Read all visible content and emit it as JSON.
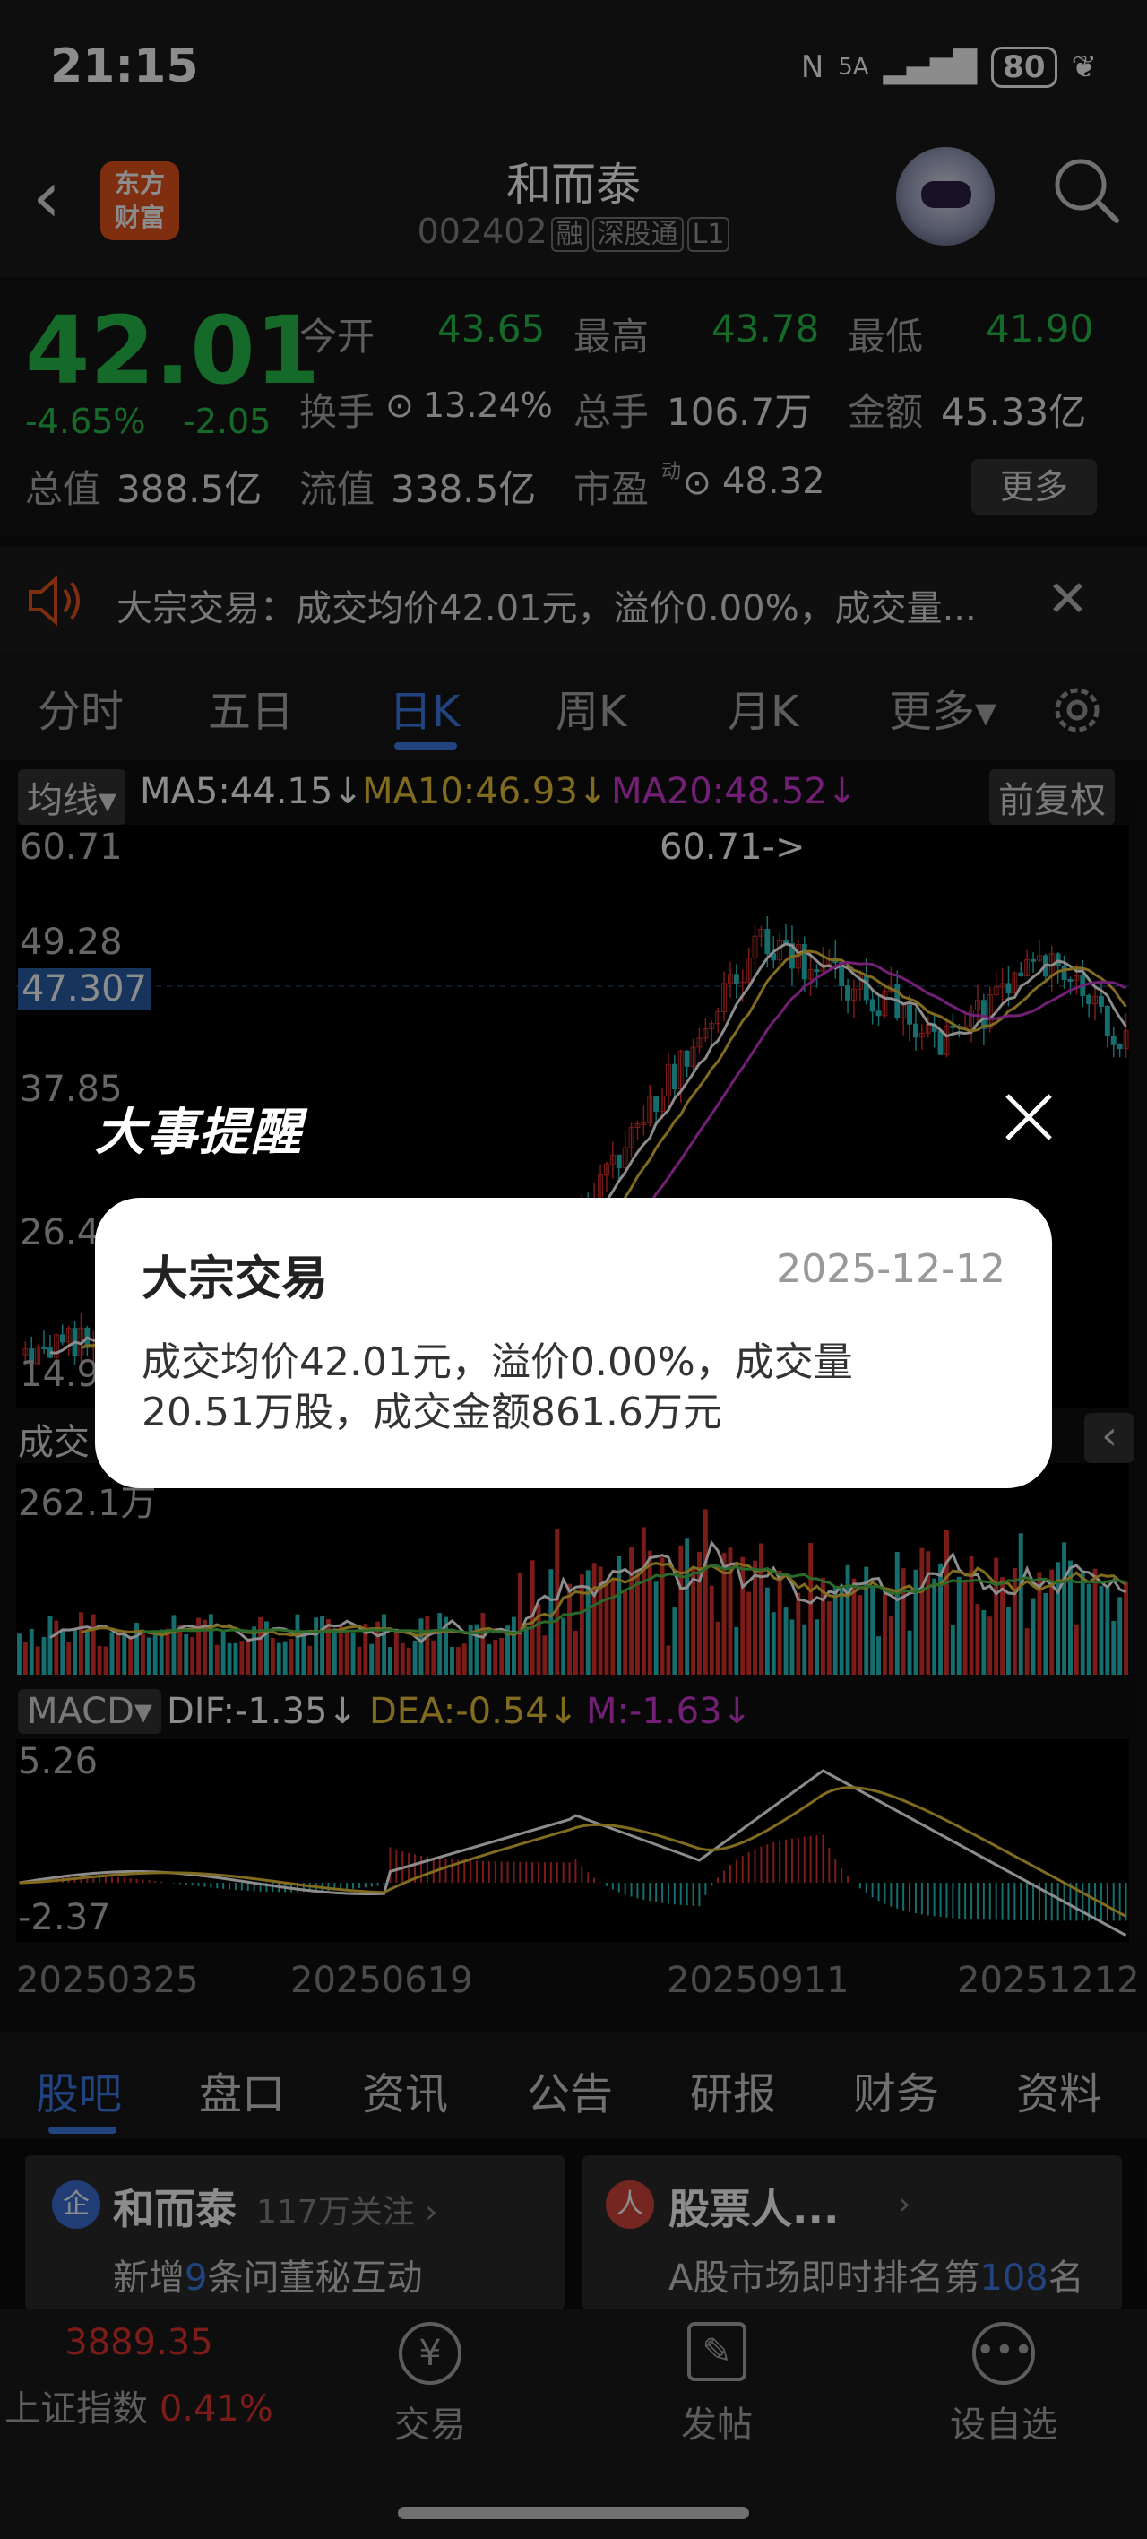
{
  "status_bar": {
    "time": "21:15",
    "network": "5A",
    "battery": "80"
  },
  "header": {
    "logo_text": "东方\n财富",
    "name": "和而泰",
    "code": "002402",
    "tags": [
      "融",
      "深股通",
      "L1"
    ]
  },
  "quote": {
    "price": "42.01",
    "change_pct": "-4.65%",
    "change_amt": "-2.05",
    "open_label": "今开",
    "open": "43.65",
    "high_label": "最高",
    "high": "43.78",
    "low_label": "最低",
    "low": "41.90",
    "turnover_label": "换手",
    "turnover": "13.24%",
    "volume_label": "总手",
    "volume": "106.7万",
    "amount_label": "金额",
    "amount": "45.33亿",
    "total_cap_label": "总值",
    "total_cap": "388.5亿",
    "float_cap_label": "流值",
    "float_cap": "338.5亿",
    "pe_label": "市盈",
    "pe_sup": "动",
    "pe": "48.32",
    "more_label": "更多"
  },
  "notice": {
    "text": "大宗交易：成交均价42.01元，溢价0.00%，成交量..."
  },
  "chart_tabs": {
    "items": [
      "分时",
      "五日",
      "日K",
      "周K",
      "月K",
      "更多▾"
    ],
    "active": "日K"
  },
  "indicators": {
    "ma_label": "均线",
    "ma5": "MA5:44.15",
    "ma10": "MA10:46.93",
    "ma20": "MA20:48.52",
    "adjust_label": "前复权",
    "price_high_tag": "60.71->",
    "price_ticks": [
      "60.71",
      "49.28",
      "47.307",
      "37.85",
      "26.4",
      "14.9"
    ],
    "volume_label": "成交",
    "volume_tick": "262.1万",
    "macd_label": "MACD",
    "dif": "DIF:-1.35",
    "dea": "DEA:-0.54",
    "m": "M:-1.63",
    "macd_ticks": [
      "5.26",
      "-2.37"
    ],
    "dates": [
      "20250325",
      "20250619",
      "20250911",
      "20251212"
    ],
    "colors": {
      "ma5": "#ffffff",
      "ma10": "#e9c43a",
      "ma20": "#d23ad8",
      "up": "#e0332f",
      "down": "#29c6c6"
    }
  },
  "overlay": {
    "heading": "大事提醒",
    "dialog_title": "大宗交易",
    "dialog_date": "2025-12-12",
    "dialog_body": "成交均价42.01元，溢价0.00%，成交量20.51万股，成交金额861.6万元"
  },
  "bottom_tabs": {
    "items": [
      "股吧",
      "盘口",
      "资讯",
      "公告",
      "研报",
      "财务",
      "资料"
    ],
    "active": "股吧"
  },
  "cards": [
    {
      "badge": "企",
      "title": "和而泰",
      "follow": "117万关注",
      "sub_pre": "新增",
      "sub_num": "9",
      "sub_post": "条问董秘互动"
    },
    {
      "badge": "人",
      "title": "股票人...",
      "sub_pre": "A股市场即时排名第",
      "sub_num": "108",
      "sub_post": "名"
    }
  ],
  "bottom_bar": {
    "index_value": "3889.35",
    "index_label": "上证指数",
    "index_pct": "0.41%",
    "trade_label": "交易",
    "post_label": "发帖",
    "watch_label": "设自选"
  }
}
